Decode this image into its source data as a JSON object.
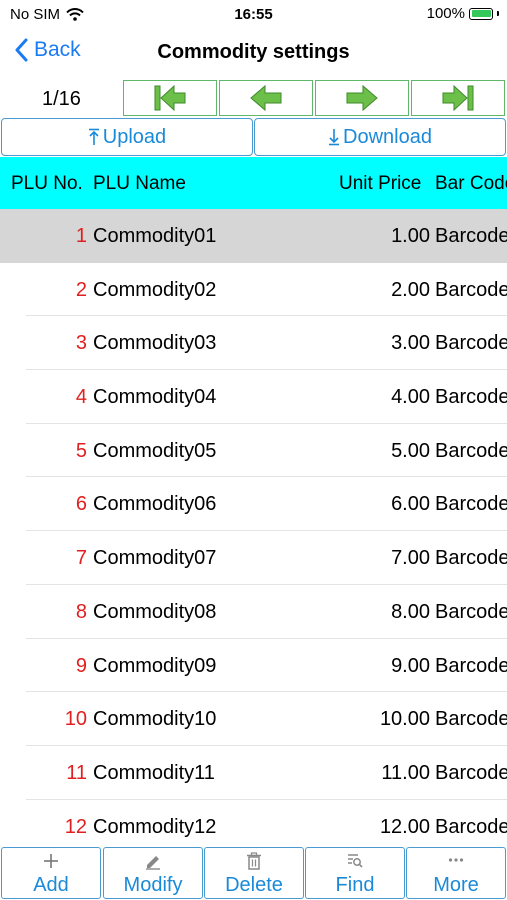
{
  "status": {
    "carrier": "No SIM",
    "time": "16:55",
    "battery": "100%"
  },
  "nav": {
    "back_label": "Back",
    "title": "Commodity settings"
  },
  "pager": {
    "indicator": "1/16"
  },
  "actions": {
    "upload_label": "Upload",
    "download_label": "Download"
  },
  "table": {
    "headers": {
      "plu_no": "PLU No.",
      "plu_name": "PLU Name",
      "unit_price": "Unit Price",
      "bar_code": "Bar Code"
    },
    "rows": [
      {
        "no": "1",
        "name": "Commodity01",
        "price": "1.00",
        "barcode": "Barcode"
      },
      {
        "no": "2",
        "name": "Commodity02",
        "price": "2.00",
        "barcode": "Barcode"
      },
      {
        "no": "3",
        "name": "Commodity03",
        "price": "3.00",
        "barcode": "Barcode"
      },
      {
        "no": "4",
        "name": "Commodity04",
        "price": "4.00",
        "barcode": "Barcode"
      },
      {
        "no": "5",
        "name": "Commodity05",
        "price": "5.00",
        "barcode": "Barcode"
      },
      {
        "no": "6",
        "name": "Commodity06",
        "price": "6.00",
        "barcode": "Barcode"
      },
      {
        "no": "7",
        "name": "Commodity07",
        "price": "7.00",
        "barcode": "Barcode"
      },
      {
        "no": "8",
        "name": "Commodity08",
        "price": "8.00",
        "barcode": "Barcode"
      },
      {
        "no": "9",
        "name": "Commodity09",
        "price": "9.00",
        "barcode": "Barcode"
      },
      {
        "no": "10",
        "name": "Commodity10",
        "price": "10.00",
        "barcode": "Barcode"
      },
      {
        "no": "11",
        "name": "Commodity11",
        "price": "11.00",
        "barcode": "Barcode"
      },
      {
        "no": "12",
        "name": "Commodity12",
        "price": "12.00",
        "barcode": "Barcode"
      }
    ]
  },
  "toolbar": {
    "add": "Add",
    "modify": "Modify",
    "delete": "Delete",
    "find": "Find",
    "more": "More"
  },
  "icons": {
    "wifi": "wifi-icon",
    "battery": "battery-charging-icon",
    "back": "chevron-left-icon",
    "first": "first-page-icon",
    "prev": "prev-page-icon",
    "next": "next-page-icon",
    "last": "last-page-icon",
    "upload": "upload-icon",
    "download": "download-icon",
    "add": "plus-icon",
    "modify": "pencil-icon",
    "delete": "trash-icon",
    "find": "search-list-icon",
    "more": "ellipsis-icon"
  },
  "colors": {
    "header_bg": "#00ffff",
    "accent": "#1a7bf2",
    "row_number": "#e02020",
    "pager_arrow": "#6cc04a",
    "selected_row": "#d6d6d6"
  }
}
